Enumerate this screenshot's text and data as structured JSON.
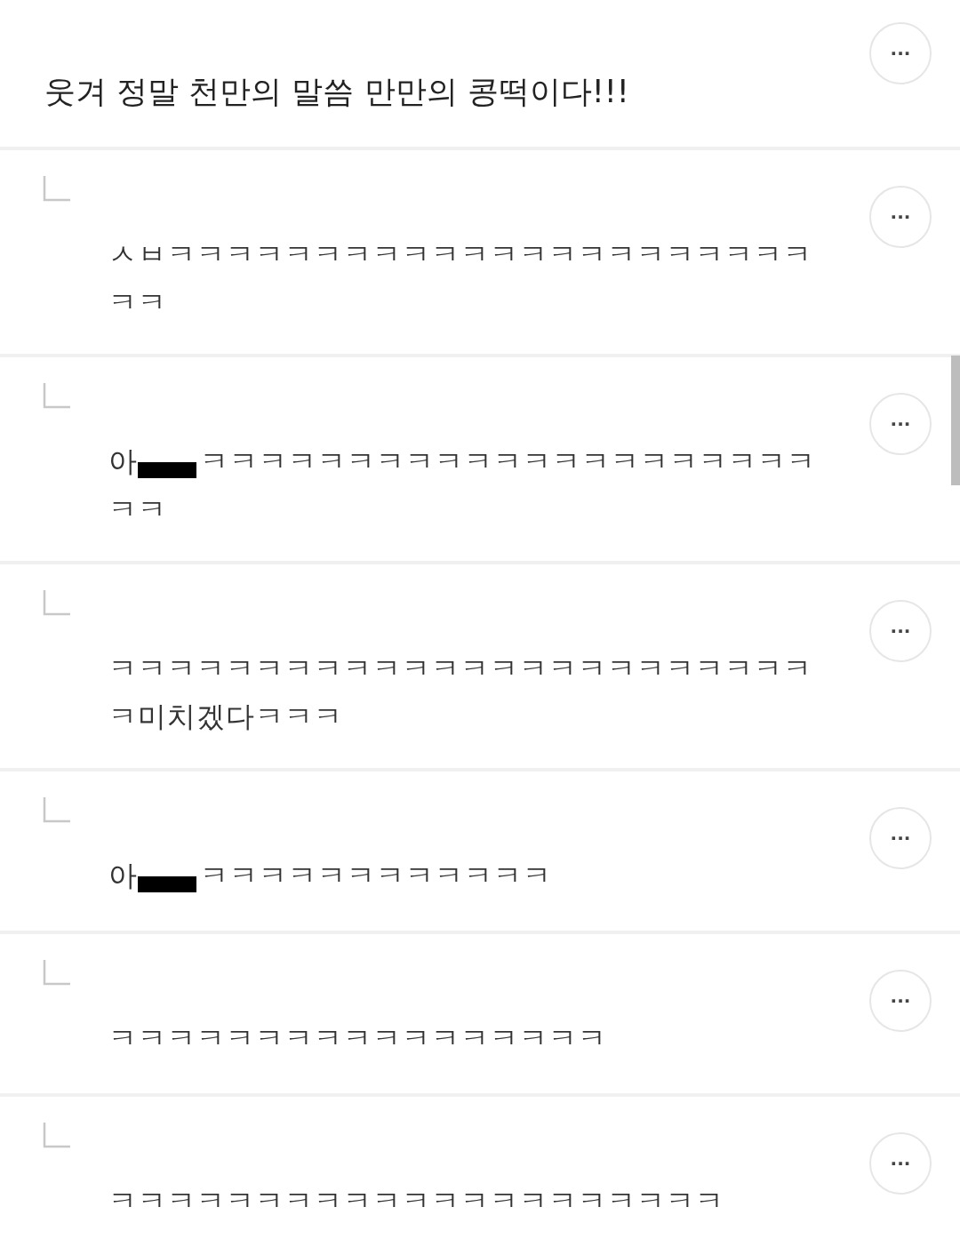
{
  "post": {
    "text": "웃겨 정말 천만의 말씀 만만의 콩떡이다!!!",
    "more": "···"
  },
  "replies": [
    {
      "lines": [
        "ㅅㅂㅋㅋㅋㅋㅋㅋㅋㅋㅋㅋㅋㅋㅋㅋㅋㅋㅋㅋㅋㅋㅋㅋ",
        "ㅋㅋ"
      ],
      "more": "···"
    },
    {
      "prefix": "아",
      "lines": [
        "ㅋㅋㅋㅋㅋㅋㅋㅋㅋㅋㅋㅋㅋㅋㅋㅋㅋㅋㅋㅋㅋ",
        "ㅋㅋ"
      ],
      "more": "···"
    },
    {
      "lines": [
        "ㅋㅋㅋㅋㅋㅋㅋㅋㅋㅋㅋㅋㅋㅋㅋㅋㅋㅋㅋㅋㅋㅋㅋㅋ",
        "ㅋ미치겠다ㅋㅋㅋ"
      ],
      "more": "···"
    },
    {
      "prefix": "아",
      "lines": [
        "ㅋㅋㅋㅋㅋㅋㅋㅋㅋㅋㅋㅋ"
      ],
      "more": "···"
    },
    {
      "lines": [
        "ㅋㅋㅋㅋㅋㅋㅋㅋㅋㅋㅋㅋㅋㅋㅋㅋㅋ"
      ],
      "more": "···"
    },
    {
      "lines": [
        "ㅋㅋㅋㅋㅋㅋㅋㅋㅋㅋㅋㅋㅋㅋㅋㅋㅋㅋㅋㅋㅋ"
      ],
      "more": "···"
    }
  ]
}
